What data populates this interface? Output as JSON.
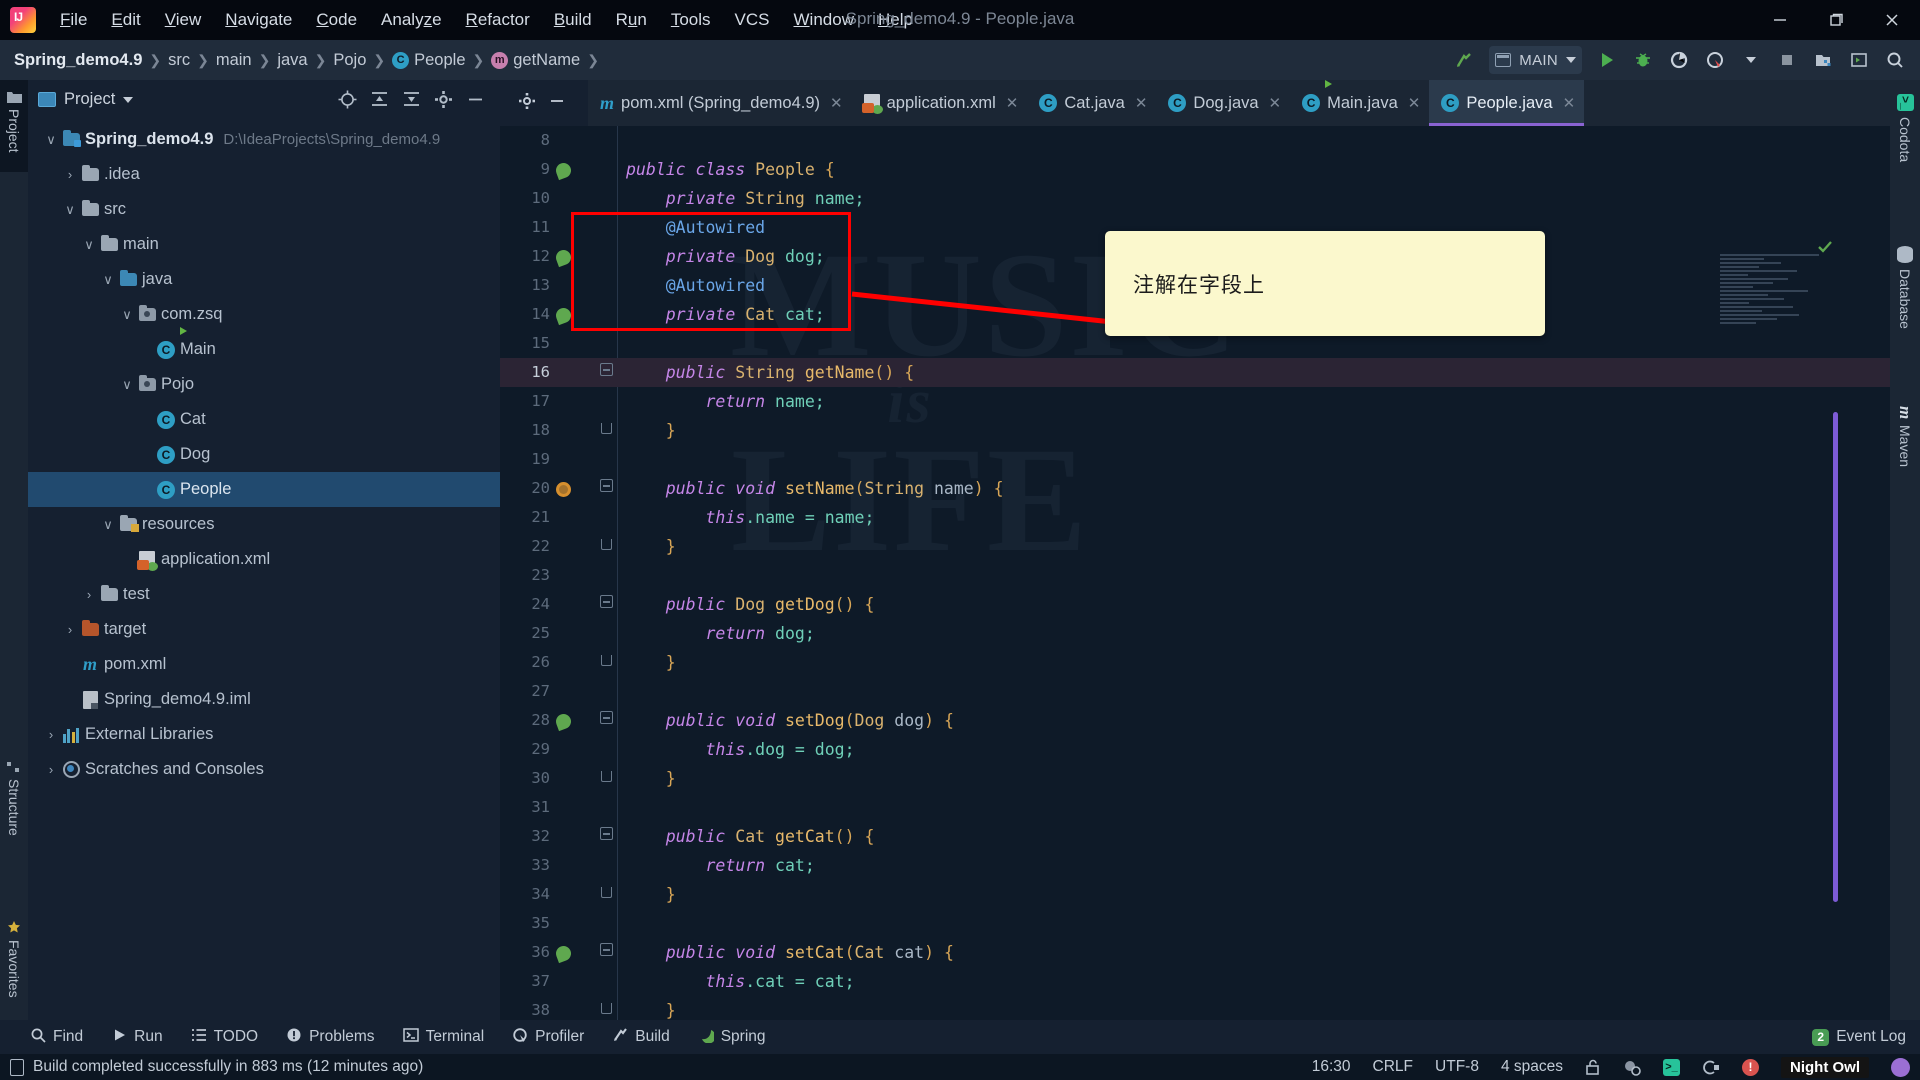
{
  "window": {
    "title": "Spring_demo4.9 - People.java",
    "minimize": "—",
    "restore": "❐",
    "close": "✕"
  },
  "menu": {
    "items": [
      {
        "label": "File",
        "mnemonic": "F"
      },
      {
        "label": "Edit",
        "mnemonic": "E"
      },
      {
        "label": "View",
        "mnemonic": "V"
      },
      {
        "label": "Navigate",
        "mnemonic": "N"
      },
      {
        "label": "Code",
        "mnemonic": "C"
      },
      {
        "label": "Analyze",
        "mnemonic": "z"
      },
      {
        "label": "Refactor",
        "mnemonic": "R"
      },
      {
        "label": "Build",
        "mnemonic": "B"
      },
      {
        "label": "Run",
        "mnemonic": "u"
      },
      {
        "label": "Tools",
        "mnemonic": "T"
      },
      {
        "label": "VCS",
        "mnemonic": ""
      },
      {
        "label": "Window",
        "mnemonic": "W"
      },
      {
        "label": "Help",
        "mnemonic": "H"
      }
    ]
  },
  "navbar": {
    "breadcrumbs": [
      {
        "label": "Spring_demo4.9",
        "icon": "",
        "bold": true
      },
      {
        "label": "src",
        "icon": ""
      },
      {
        "label": "main",
        "icon": ""
      },
      {
        "label": "java",
        "icon": ""
      },
      {
        "label": "Pojo",
        "icon": ""
      },
      {
        "label": "People",
        "icon": "class-icon"
      },
      {
        "label": "getName",
        "icon": "method-icon"
      }
    ],
    "run_config": "MAIN",
    "actions": [
      "build-icon",
      "run-icon",
      "debug-icon",
      "coverage-icon",
      "profile-icon",
      "stop-icon",
      "project-structure-icon",
      "search-everywhere-icon"
    ]
  },
  "left_strip": {
    "tabs": [
      "Project",
      "Structure",
      "Favorites"
    ]
  },
  "right_strip": {
    "tabs": [
      "Codota",
      "Database",
      "Maven"
    ]
  },
  "project_panel": {
    "title": "Project",
    "toolbar": [
      "locate-icon",
      "expand-all-icon",
      "collapse-all-icon",
      "settings-icon",
      "hide-icon"
    ],
    "tree": [
      {
        "label": "Spring_demo4.9",
        "sub": "D:\\IdeaProjects\\Spring_demo4.9",
        "depth": 0,
        "arrow": "down",
        "icon": "module-folder-icon",
        "bold": true,
        "selected": false
      },
      {
        "label": ".idea",
        "sub": "",
        "depth": 1,
        "arrow": "right",
        "icon": "folder-icon",
        "bold": false,
        "selected": false
      },
      {
        "label": "src",
        "sub": "",
        "depth": 1,
        "arrow": "down",
        "icon": "folder-icon",
        "bold": false,
        "selected": false
      },
      {
        "label": "main",
        "sub": "",
        "depth": 2,
        "arrow": "down",
        "icon": "folder-icon",
        "bold": false,
        "selected": false
      },
      {
        "label": "java",
        "sub": "",
        "depth": 3,
        "arrow": "down",
        "icon": "source-folder-icon",
        "bold": false,
        "selected": false
      },
      {
        "label": "com.zsq",
        "sub": "",
        "depth": 4,
        "arrow": "down",
        "icon": "package-icon",
        "bold": false,
        "selected": false
      },
      {
        "label": "Main",
        "sub": "",
        "depth": 5,
        "arrow": "none",
        "icon": "runnable-class-icon",
        "bold": false,
        "selected": false
      },
      {
        "label": "Pojo",
        "sub": "",
        "depth": 4,
        "arrow": "down",
        "icon": "package-icon",
        "bold": false,
        "selected": false
      },
      {
        "label": "Cat",
        "sub": "",
        "depth": 5,
        "arrow": "none",
        "icon": "class-icon",
        "bold": false,
        "selected": false
      },
      {
        "label": "Dog",
        "sub": "",
        "depth": 5,
        "arrow": "none",
        "icon": "class-icon",
        "bold": false,
        "selected": false
      },
      {
        "label": "People",
        "sub": "",
        "depth": 5,
        "arrow": "none",
        "icon": "class-icon",
        "bold": false,
        "selected": true
      },
      {
        "label": "resources",
        "sub": "",
        "depth": 3,
        "arrow": "down",
        "icon": "resources-folder-icon",
        "bold": false,
        "selected": false
      },
      {
        "label": "application.xml",
        "sub": "",
        "depth": 4,
        "arrow": "none",
        "icon": "spring-xml-icon",
        "bold": false,
        "selected": false
      },
      {
        "label": "test",
        "sub": "",
        "depth": 2,
        "arrow": "right",
        "icon": "folder-icon",
        "bold": false,
        "selected": false
      },
      {
        "label": "target",
        "sub": "",
        "depth": 1,
        "arrow": "right",
        "icon": "excluded-folder-icon",
        "bold": false,
        "selected": false
      },
      {
        "label": "pom.xml",
        "sub": "",
        "depth": 1,
        "arrow": "none",
        "icon": "maven-icon",
        "bold": false,
        "selected": false
      },
      {
        "label": "Spring_demo4.9.iml",
        "sub": "",
        "depth": 1,
        "arrow": "none",
        "icon": "iml-icon",
        "bold": false,
        "selected": false
      },
      {
        "label": "External Libraries",
        "sub": "",
        "depth": 0,
        "arrow": "right",
        "icon": "libraries-icon",
        "bold": false,
        "selected": false
      },
      {
        "label": "Scratches and Consoles",
        "sub": "",
        "depth": 0,
        "arrow": "right",
        "icon": "scratches-icon",
        "bold": false,
        "selected": false
      }
    ]
  },
  "editor": {
    "tabs": [
      {
        "label": "pom.xml (Spring_demo4.9)",
        "icon": "maven-icon",
        "active": false
      },
      {
        "label": "application.xml",
        "icon": "spring-xml-icon",
        "active": false
      },
      {
        "label": "Cat.java",
        "icon": "class-icon",
        "active": false
      },
      {
        "label": "Dog.java",
        "icon": "class-icon",
        "active": false
      },
      {
        "label": "Main.java",
        "icon": "runnable-class-icon",
        "active": false
      },
      {
        "label": "People.java",
        "icon": "class-icon",
        "active": true
      }
    ],
    "close_glyph": "✕",
    "watermark": {
      "top": "MUSIC",
      "mid": "is",
      "bottom": "LIFE"
    },
    "current_line": 16,
    "lines": [
      {
        "num": 8,
        "gutter": "none",
        "fold": "none",
        "indent": 0,
        "tokens": []
      },
      {
        "num": 9,
        "gutter": "bean",
        "fold": "none",
        "indent": 0,
        "tokens": [
          {
            "t": "public ",
            "c": "kwi"
          },
          {
            "t": "class ",
            "c": "kwi"
          },
          {
            "t": "People",
            "c": "typ"
          },
          {
            "t": " {",
            "c": "br1"
          }
        ]
      },
      {
        "num": 10,
        "gutter": "none",
        "fold": "none",
        "indent": 1,
        "tokens": [
          {
            "t": "private ",
            "c": "kwi"
          },
          {
            "t": "String",
            "c": "typ"
          },
          {
            "t": " name;",
            "c": "var"
          }
        ]
      },
      {
        "num": 11,
        "gutter": "none",
        "fold": "none",
        "indent": 1,
        "tokens": [
          {
            "t": "@Autowired",
            "c": "ann"
          }
        ]
      },
      {
        "num": 12,
        "gutter": "arrow",
        "fold": "none",
        "indent": 1,
        "tokens": [
          {
            "t": "private ",
            "c": "kwi"
          },
          {
            "t": "Dog",
            "c": "typ"
          },
          {
            "t": " dog;",
            "c": "var"
          }
        ]
      },
      {
        "num": 13,
        "gutter": "none",
        "fold": "none",
        "indent": 1,
        "tokens": [
          {
            "t": "@Autowired",
            "c": "ann"
          }
        ]
      },
      {
        "num": 14,
        "gutter": "arrow",
        "fold": "none",
        "indent": 1,
        "tokens": [
          {
            "t": "private ",
            "c": "kwi"
          },
          {
            "t": "Cat",
            "c": "typ"
          },
          {
            "t": " cat;",
            "c": "var"
          }
        ]
      },
      {
        "num": 15,
        "gutter": "none",
        "fold": "none",
        "indent": 0,
        "tokens": []
      },
      {
        "num": 16,
        "gutter": "none",
        "fold": "open",
        "indent": 1,
        "tokens": [
          {
            "t": "public ",
            "c": "kwi"
          },
          {
            "t": "String",
            "c": "typ"
          },
          {
            "t": " ",
            "c": "pl"
          },
          {
            "t": "getName",
            "c": "fn"
          },
          {
            "t": "() ",
            "c": "br1"
          },
          {
            "t": "{",
            "c": "br1"
          }
        ]
      },
      {
        "num": 17,
        "gutter": "none",
        "fold": "none",
        "indent": 2,
        "tokens": [
          {
            "t": "return ",
            "c": "kwp"
          },
          {
            "t": "name;",
            "c": "var"
          }
        ]
      },
      {
        "num": 18,
        "gutter": "none",
        "fold": "close",
        "indent": 1,
        "tokens": [
          {
            "t": "}",
            "c": "br1"
          }
        ]
      },
      {
        "num": 19,
        "gutter": "none",
        "fold": "none",
        "indent": 0,
        "tokens": []
      },
      {
        "num": 20,
        "gutter": "bean2",
        "fold": "open",
        "indent": 1,
        "tokens": [
          {
            "t": "public ",
            "c": "kwi"
          },
          {
            "t": "void ",
            "c": "kwi"
          },
          {
            "t": "setName",
            "c": "fn"
          },
          {
            "t": "(",
            "c": "br1"
          },
          {
            "t": "String",
            "c": "typ"
          },
          {
            "t": " name",
            "c": "pl"
          },
          {
            "t": ") ",
            "c": "br1"
          },
          {
            "t": "{",
            "c": "br1"
          }
        ]
      },
      {
        "num": 21,
        "gutter": "none",
        "fold": "none",
        "indent": 2,
        "tokens": [
          {
            "t": "this",
            "c": "kwp"
          },
          {
            "t": ".name = name;",
            "c": "var"
          }
        ]
      },
      {
        "num": 22,
        "gutter": "none",
        "fold": "close",
        "indent": 1,
        "tokens": [
          {
            "t": "}",
            "c": "br1"
          }
        ]
      },
      {
        "num": 23,
        "gutter": "none",
        "fold": "none",
        "indent": 0,
        "tokens": []
      },
      {
        "num": 24,
        "gutter": "none",
        "fold": "open",
        "indent": 1,
        "tokens": [
          {
            "t": "public ",
            "c": "kwi"
          },
          {
            "t": "Dog",
            "c": "typ"
          },
          {
            "t": " ",
            "c": "pl"
          },
          {
            "t": "getDog",
            "c": "fn"
          },
          {
            "t": "() ",
            "c": "br1"
          },
          {
            "t": "{",
            "c": "br1"
          }
        ]
      },
      {
        "num": 25,
        "gutter": "none",
        "fold": "none",
        "indent": 2,
        "tokens": [
          {
            "t": "return ",
            "c": "kwp"
          },
          {
            "t": "dog;",
            "c": "var"
          }
        ]
      },
      {
        "num": 26,
        "gutter": "none",
        "fold": "close",
        "indent": 1,
        "tokens": [
          {
            "t": "}",
            "c": "br1"
          }
        ]
      },
      {
        "num": 27,
        "gutter": "none",
        "fold": "none",
        "indent": 0,
        "tokens": []
      },
      {
        "num": 28,
        "gutter": "arrow",
        "fold": "open",
        "indent": 1,
        "tokens": [
          {
            "t": "public ",
            "c": "kwi"
          },
          {
            "t": "void ",
            "c": "kwi"
          },
          {
            "t": "setDog",
            "c": "fn"
          },
          {
            "t": "(",
            "c": "br1"
          },
          {
            "t": "Dog",
            "c": "typ"
          },
          {
            "t": " dog",
            "c": "pl"
          },
          {
            "t": ") ",
            "c": "br1"
          },
          {
            "t": "{",
            "c": "br1"
          }
        ]
      },
      {
        "num": 29,
        "gutter": "none",
        "fold": "none",
        "indent": 2,
        "tokens": [
          {
            "t": "this",
            "c": "kwp"
          },
          {
            "t": ".dog = dog;",
            "c": "var"
          }
        ]
      },
      {
        "num": 30,
        "gutter": "none",
        "fold": "close",
        "indent": 1,
        "tokens": [
          {
            "t": "}",
            "c": "br1"
          }
        ]
      },
      {
        "num": 31,
        "gutter": "none",
        "fold": "none",
        "indent": 0,
        "tokens": []
      },
      {
        "num": 32,
        "gutter": "none",
        "fold": "open",
        "indent": 1,
        "tokens": [
          {
            "t": "public ",
            "c": "kwi"
          },
          {
            "t": "Cat",
            "c": "typ"
          },
          {
            "t": " ",
            "c": "pl"
          },
          {
            "t": "getCat",
            "c": "fn"
          },
          {
            "t": "() ",
            "c": "br1"
          },
          {
            "t": "{",
            "c": "br1"
          }
        ]
      },
      {
        "num": 33,
        "gutter": "none",
        "fold": "none",
        "indent": 2,
        "tokens": [
          {
            "t": "return ",
            "c": "kwp"
          },
          {
            "t": "cat;",
            "c": "var"
          }
        ]
      },
      {
        "num": 34,
        "gutter": "none",
        "fold": "close",
        "indent": 1,
        "tokens": [
          {
            "t": "}",
            "c": "br1"
          }
        ]
      },
      {
        "num": 35,
        "gutter": "none",
        "fold": "none",
        "indent": 0,
        "tokens": []
      },
      {
        "num": 36,
        "gutter": "arrow",
        "fold": "open",
        "indent": 1,
        "tokens": [
          {
            "t": "public ",
            "c": "kwi"
          },
          {
            "t": "void ",
            "c": "kwi"
          },
          {
            "t": "setCat",
            "c": "fn"
          },
          {
            "t": "(",
            "c": "br1"
          },
          {
            "t": "Cat",
            "c": "typ"
          },
          {
            "t": " cat",
            "c": "pl"
          },
          {
            "t": ") ",
            "c": "br1"
          },
          {
            "t": "{",
            "c": "br1"
          }
        ]
      },
      {
        "num": 37,
        "gutter": "none",
        "fold": "none",
        "indent": 2,
        "tokens": [
          {
            "t": "this",
            "c": "kwp"
          },
          {
            "t": ".cat = cat;",
            "c": "var"
          }
        ]
      },
      {
        "num": 38,
        "gutter": "none",
        "fold": "close",
        "indent": 1,
        "tokens": [
          {
            "t": "}",
            "c": "br1"
          }
        ]
      }
    ]
  },
  "annotation": {
    "tooltip_text": "注解在字段上",
    "highlight_color": "#ff0000",
    "tooltip_bg": "#fbf8cd"
  },
  "tool_window_bar": {
    "buttons": [
      {
        "label": "Find",
        "icon": "search-icon"
      },
      {
        "label": "Run",
        "icon": "run-icon"
      },
      {
        "label": "TODO",
        "icon": "todo-icon"
      },
      {
        "label": "Problems",
        "icon": "problems-icon"
      },
      {
        "label": "Terminal",
        "icon": "terminal-icon"
      },
      {
        "label": "Profiler",
        "icon": "profiler-icon"
      },
      {
        "label": "Build",
        "icon": "build-icon"
      },
      {
        "label": "Spring",
        "icon": "spring-icon"
      }
    ],
    "event_log": {
      "label": "Event Log",
      "count": "2"
    }
  },
  "status_bar": {
    "message": "Build completed successfully in 883 ms (12 minutes ago)",
    "time": "16:30",
    "line_separator": "CRLF",
    "encoding": "UTF-8",
    "indent": "4 spaces",
    "icons": [
      "lock-icon",
      "inspection-icon",
      "terminal-icon",
      "plugin-icon",
      "error-icon"
    ],
    "theme": "Night Owl"
  }
}
